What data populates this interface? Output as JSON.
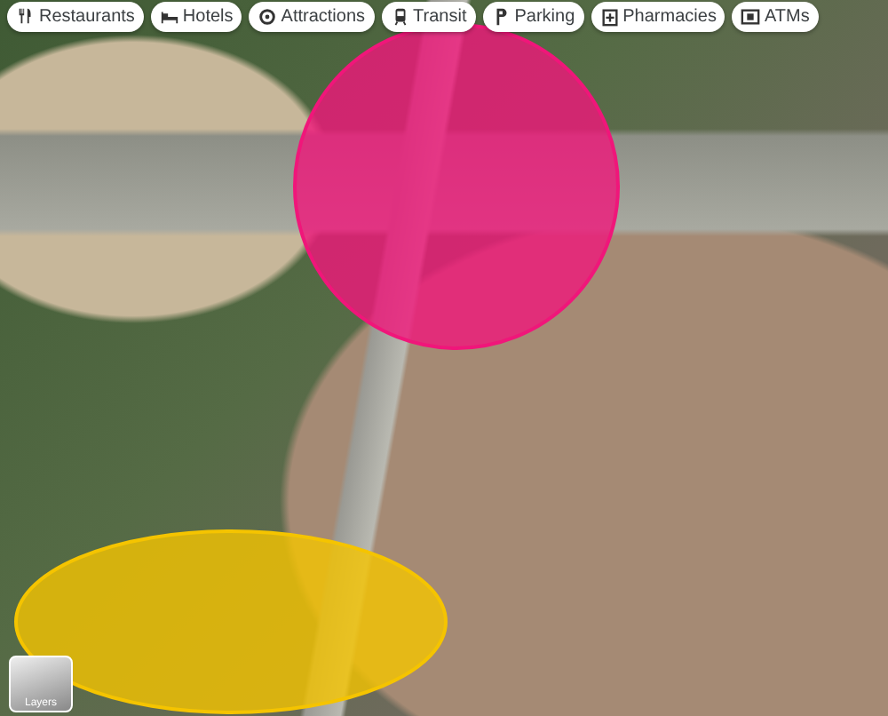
{
  "chips": [
    {
      "label": "Restaurants",
      "kind": "restaurant"
    },
    {
      "label": "Hotels",
      "kind": "hotel"
    },
    {
      "label": "Attractions",
      "kind": "attraction"
    },
    {
      "label": "Transit",
      "kind": "transit"
    },
    {
      "label": "Parking",
      "kind": "parking"
    },
    {
      "label": "Pharmacies",
      "kind": "pharmacy"
    },
    {
      "label": "ATMs",
      "kind": "atm"
    }
  ],
  "areas": [
    {
      "kind": "circle",
      "color": "#f0167a"
    },
    {
      "kind": "ellipse",
      "color": "#f5c400"
    }
  ],
  "layers_button": {
    "label": "Layers"
  }
}
